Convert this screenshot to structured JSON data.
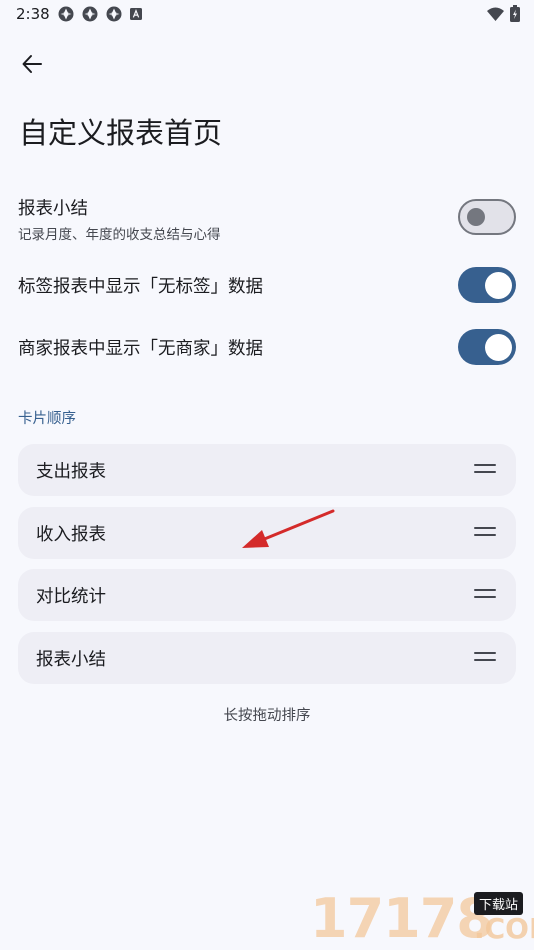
{
  "status_bar": {
    "time": "2:38",
    "left_icons": [
      "app-notification-icon",
      "app-notification-icon",
      "app-notification-icon",
      "a-notification-icon"
    ],
    "right_icons": [
      "wifi-icon",
      "battery-icon"
    ]
  },
  "header": {
    "back_icon": "arrow-left-icon",
    "title": "自定义报表首页"
  },
  "settings": [
    {
      "title": "报表小结",
      "subtitle": "记录月度、年度的收支总结与心得",
      "enabled": false
    },
    {
      "title": "标签报表中显示「无标签」数据",
      "enabled": true
    },
    {
      "title": "商家报表中显示「无商家」数据",
      "enabled": true
    }
  ],
  "card_order": {
    "label": "卡片顺序",
    "cards": [
      "支出报表",
      "收入报表",
      "对比统计",
      "报表小结"
    ],
    "handle_icon": "drag-handle-icon",
    "hint": "长按拖动排序"
  },
  "colors": {
    "background": "#f7f8fd",
    "accent": "#37608f",
    "card": "#eeeef5",
    "annotation_arrow": "#d42a2a"
  },
  "watermark": {
    "digits": "17178",
    "badge": "下载站",
    "domain": ".COM"
  }
}
